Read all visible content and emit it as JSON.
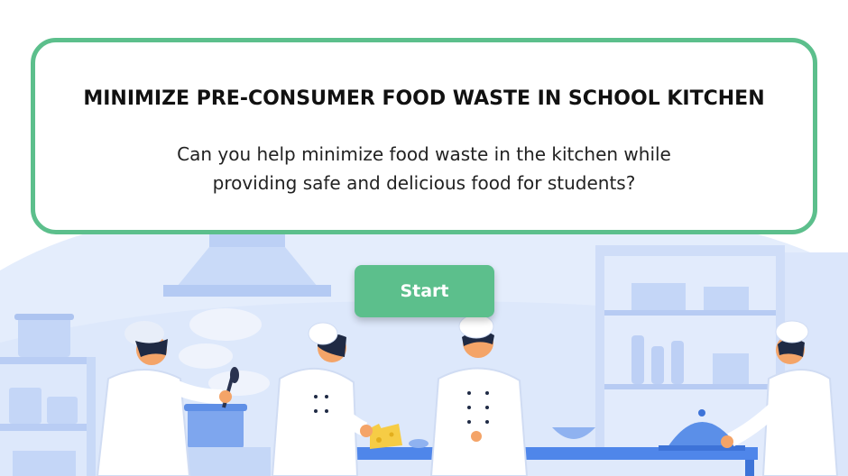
{
  "card": {
    "title": "MINIMIZE PRE-CONSUMER FOOD WASTE IN SCHOOL KITCHEN",
    "description_line1": "Can you help minimize food waste in the kitchen while",
    "description_line2": "providing safe and delicious food for students?"
  },
  "start_button": {
    "label": "Start"
  },
  "colors": {
    "accent": "#5cbf8c",
    "background_blue": "#dfe9fb",
    "furniture_blue": "#b7cdf5",
    "table_blue": "#4f86ea",
    "skin": "#f4a468",
    "hair": "#1f2a44",
    "uniform": "#ffffff"
  },
  "icons": {
    "range_hood": "range-hood-icon",
    "pot": "cooking-pot-icon",
    "cloche": "serving-cloche-icon",
    "cheese": "cheese-icon",
    "knife": "knife-icon"
  }
}
